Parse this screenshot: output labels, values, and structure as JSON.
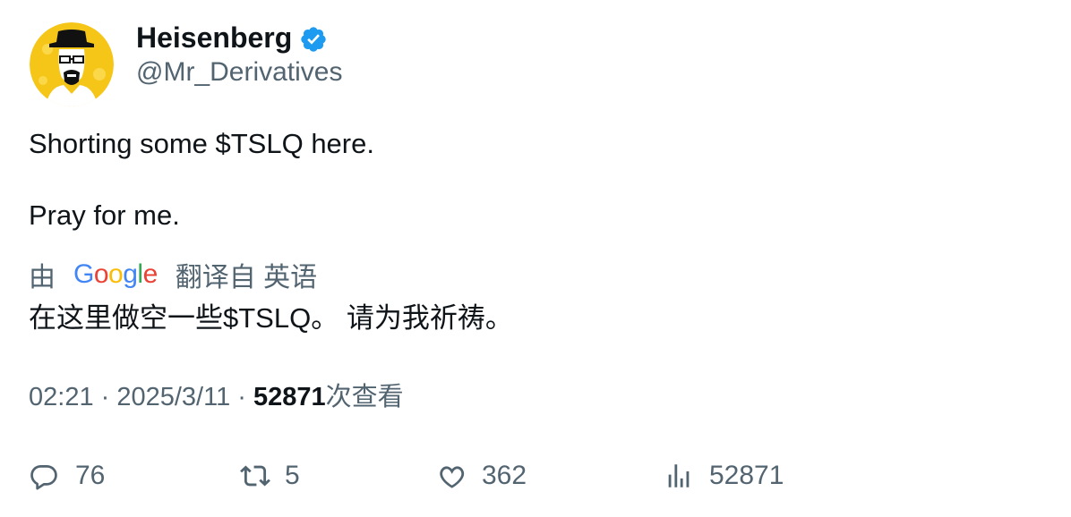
{
  "author": {
    "display_name": "Heisenberg",
    "handle": "@Mr_Derivatives",
    "verified": true,
    "verified_color": "#1d9bf0",
    "avatar_bg": "#f5c518"
  },
  "tweet": {
    "line1": "Shorting some $TSLQ here.",
    "line2": "Pray for me."
  },
  "translation": {
    "by_label": "由",
    "provider": "Google",
    "from_label": "翻译自 英语",
    "text": "在这里做空一些$TSLQ。 请为我祈祷。"
  },
  "meta": {
    "time": "02:21",
    "date": "2025/3/11",
    "views_count": "52871",
    "views_label": "次查看",
    "separator": "·"
  },
  "actions": {
    "replies": "76",
    "retweets": "5",
    "likes": "362",
    "views": "52871"
  },
  "colors": {
    "text_primary": "#0f1419",
    "text_secondary": "#536471",
    "accent": "#1d9bf0"
  }
}
